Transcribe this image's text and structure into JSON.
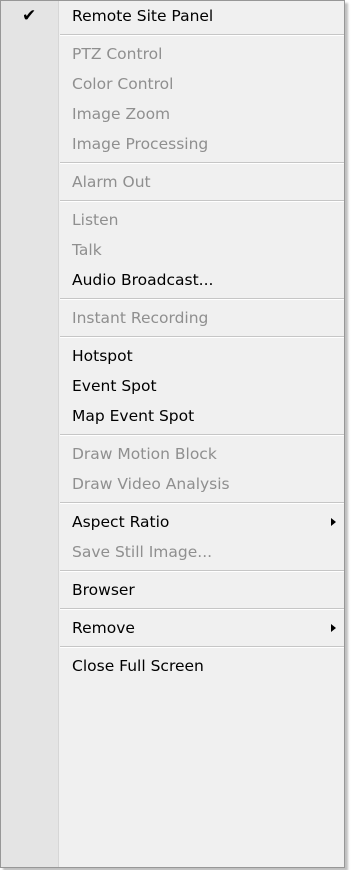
{
  "menu": {
    "items": [
      {
        "label": "Remote Site Panel",
        "enabled": true,
        "checked": true
      },
      {
        "label": "PTZ Control",
        "enabled": false
      },
      {
        "label": "Color Control",
        "enabled": false
      },
      {
        "label": "Image Zoom",
        "enabled": false
      },
      {
        "label": "Image Processing",
        "enabled": false
      },
      {
        "label": "Alarm Out",
        "enabled": false
      },
      {
        "label": "Listen",
        "enabled": false
      },
      {
        "label": "Talk",
        "enabled": false
      },
      {
        "label": "Audio Broadcast...",
        "enabled": true
      },
      {
        "label": "Instant Recording",
        "enabled": false
      },
      {
        "label": "Hotspot",
        "enabled": true
      },
      {
        "label": "Event Spot",
        "enabled": true
      },
      {
        "label": "Map Event Spot",
        "enabled": true
      },
      {
        "label": "Draw Motion Block",
        "enabled": false
      },
      {
        "label": "Draw Video Analysis",
        "enabled": false
      },
      {
        "label": "Aspect Ratio",
        "enabled": true,
        "submenu": true
      },
      {
        "label": "Save Still Image...",
        "enabled": false
      },
      {
        "label": "Browser",
        "enabled": true
      },
      {
        "label": "Remove",
        "enabled": true,
        "submenu": true
      },
      {
        "label": "Close Full Screen",
        "enabled": true
      }
    ],
    "check_glyph": "✔",
    "colors": {
      "background": "#f0f0f0",
      "gutter": "#e4e4e4",
      "enabled_text": "#000000",
      "disabled_text": "#8f8f8f",
      "separator": "#c6c6c6"
    }
  }
}
